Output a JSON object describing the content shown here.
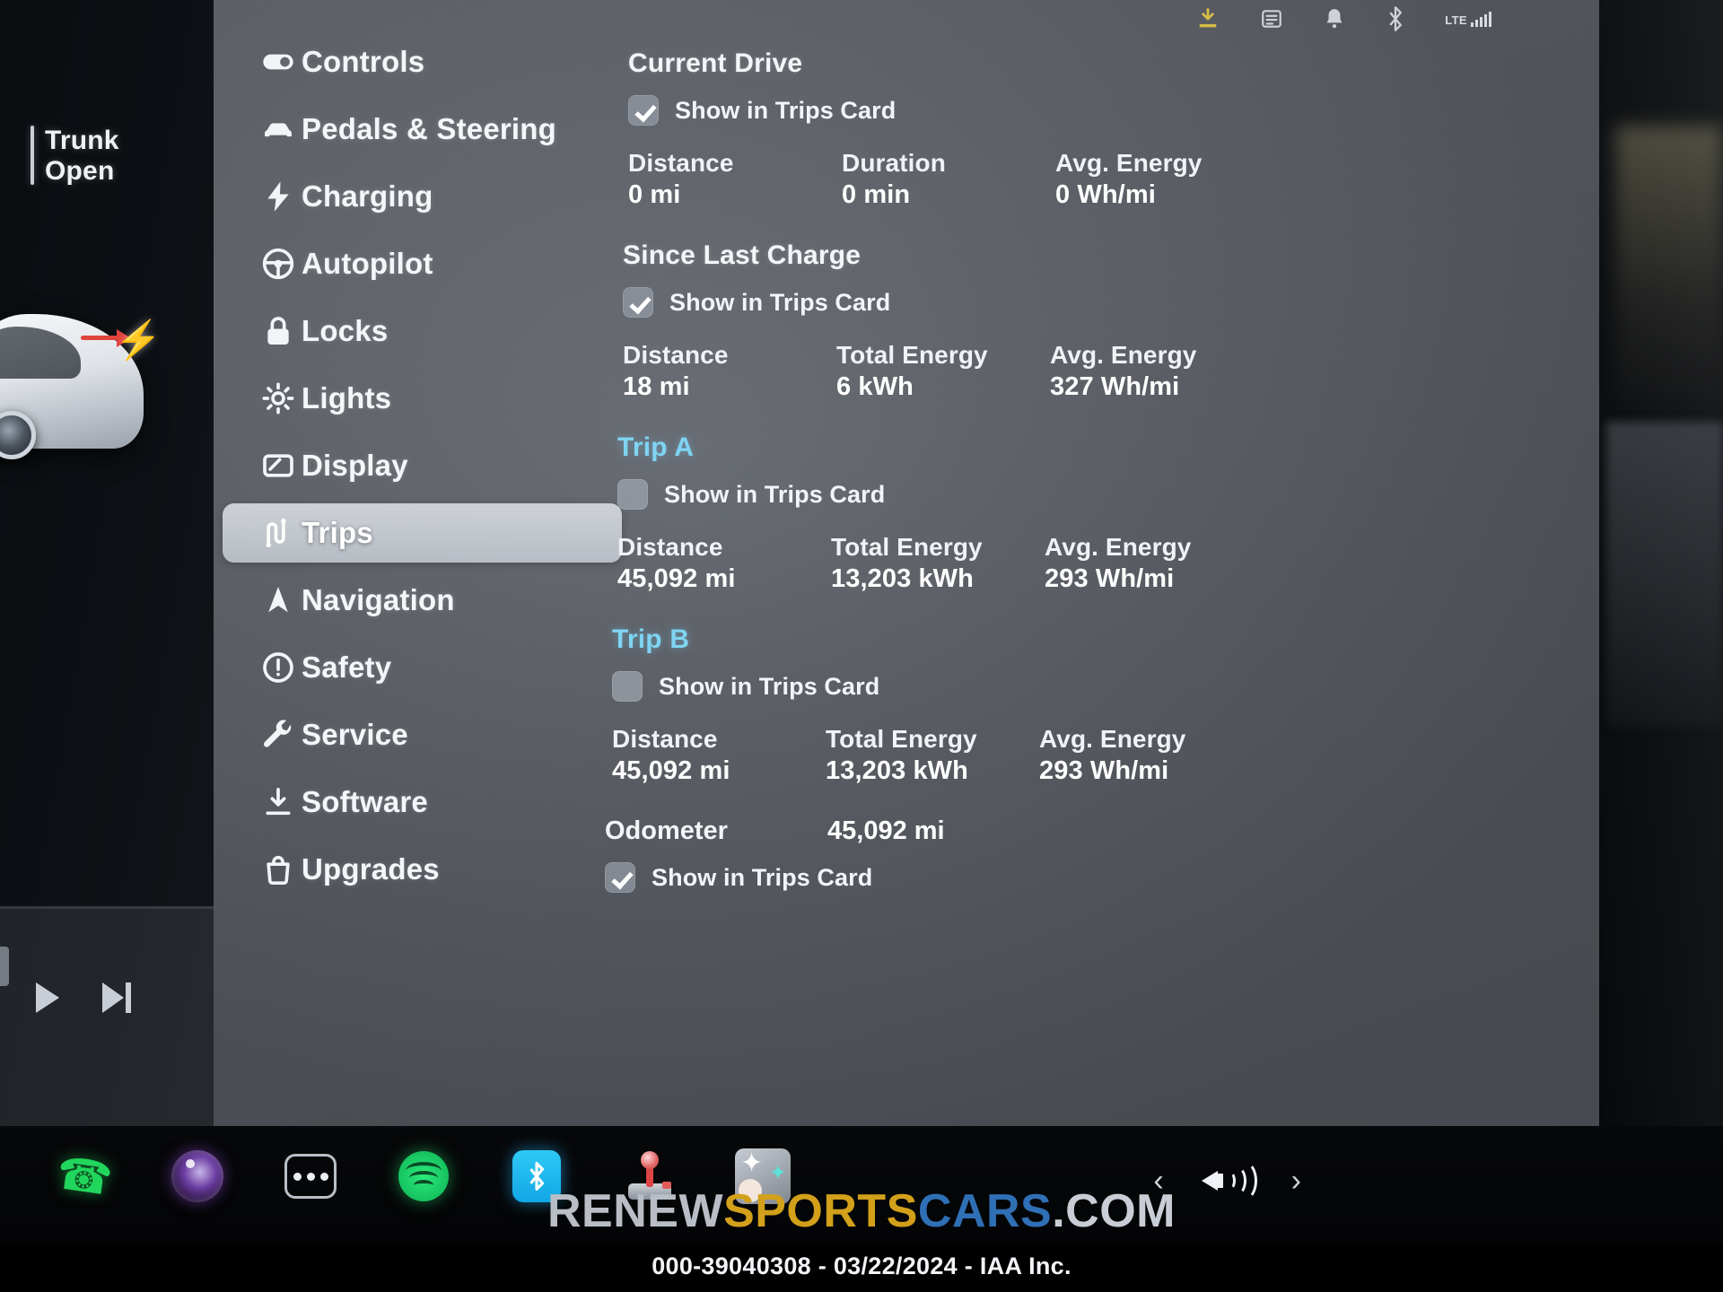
{
  "vehicle_panel": {
    "alert_line1": "Trunk",
    "alert_line2": "Open",
    "play_icon": "play-icon",
    "next_icon": "next-track-icon"
  },
  "statusbar": {
    "icons": [
      "download-icon",
      "calendar-icon",
      "bell-icon",
      "bluetooth-icon",
      "signal-icon"
    ],
    "network_label": "LTE"
  },
  "sidebar": {
    "items": [
      {
        "label": "Controls",
        "icon": "toggle-icon",
        "active": false
      },
      {
        "label": "Pedals & Steering",
        "icon": "car-icon",
        "active": false
      },
      {
        "label": "Charging",
        "icon": "bolt-icon",
        "active": false
      },
      {
        "label": "Autopilot",
        "icon": "steering-icon",
        "active": false
      },
      {
        "label": "Locks",
        "icon": "lock-icon",
        "active": false
      },
      {
        "label": "Lights",
        "icon": "light-icon",
        "active": false
      },
      {
        "label": "Display",
        "icon": "display-icon",
        "active": false
      },
      {
        "label": "Trips",
        "icon": "trips-icon",
        "active": true
      },
      {
        "label": "Navigation",
        "icon": "navigation-icon",
        "active": false
      },
      {
        "label": "Safety",
        "icon": "warning-icon",
        "active": false
      },
      {
        "label": "Service",
        "icon": "wrench-icon",
        "active": false
      },
      {
        "label": "Software",
        "icon": "download-icon",
        "active": false
      },
      {
        "label": "Upgrades",
        "icon": "bag-icon",
        "active": false
      }
    ]
  },
  "content": {
    "current_drive": {
      "title": "Current Drive",
      "show_label": "Show in Trips Card",
      "show_checked": true,
      "stats": [
        {
          "label": "Distance",
          "value": "0 mi"
        },
        {
          "label": "Duration",
          "value": "0 min"
        },
        {
          "label": "Avg. Energy",
          "value": "0 Wh/mi"
        }
      ]
    },
    "since_last_charge": {
      "title": "Since Last Charge",
      "show_label": "Show in Trips Card",
      "show_checked": true,
      "stats": [
        {
          "label": "Distance",
          "value": "18 mi"
        },
        {
          "label": "Total Energy",
          "value": "6 kWh"
        },
        {
          "label": "Avg. Energy",
          "value": "327 Wh/mi"
        }
      ]
    },
    "trip_a": {
      "title": "Trip A",
      "show_label": "Show in Trips Card",
      "show_checked": false,
      "stats": [
        {
          "label": "Distance",
          "value": "45,092 mi"
        },
        {
          "label": "Total Energy",
          "value": "13,203 kWh"
        },
        {
          "label": "Avg. Energy",
          "value": "293 Wh/mi"
        }
      ]
    },
    "trip_b": {
      "title": "Trip B",
      "show_label": "Show in Trips Card",
      "show_checked": false,
      "stats": [
        {
          "label": "Distance",
          "value": "45,092 mi"
        },
        {
          "label": "Total Energy",
          "value": "13,203 kWh"
        },
        {
          "label": "Avg. Energy",
          "value": "293 Wh/mi"
        }
      ]
    },
    "odometer": {
      "label": "Odometer",
      "value": "45,092 mi",
      "show_label": "Show in Trips Card",
      "show_checked": true
    }
  },
  "taskbar": {
    "apps": [
      {
        "name": "phone-app",
        "icon": "phone-icon"
      },
      {
        "name": "camera-app",
        "icon": "camera-icon"
      },
      {
        "name": "more-apps",
        "icon": "ellipsis-icon"
      },
      {
        "name": "spotify-app",
        "icon": "spotify-icon"
      },
      {
        "name": "bluetooth-app",
        "icon": "bluetooth-icon"
      },
      {
        "name": "joystick-app",
        "icon": "joystick-icon"
      },
      {
        "name": "toybox-app",
        "icon": "toybox-icon"
      }
    ],
    "prev_icon": "chevron-left-icon",
    "next_icon": "chevron-right-icon",
    "volume_icon": "volume-icon"
  },
  "watermark": {
    "part1": "RENEW",
    "part2": "SPORTS",
    "part3": "CARS",
    "part4": ".COM"
  },
  "caption": "000-39040308 - 03/22/2024 - IAA Inc.",
  "colors": {
    "accent_blue": "#7fd4f2",
    "screen_bg": "#63676e",
    "active_item": "#d6dae0",
    "status_yellow": "#e2c544"
  }
}
